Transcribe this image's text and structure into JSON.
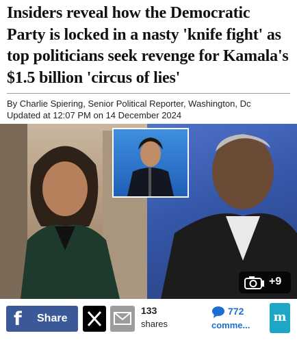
{
  "article": {
    "headline": "Insiders reveal how the Democratic Party is locked in a nasty 'knife fight' as top politicians seek revenge for Kamala's $1.5 billion 'circus of lies'",
    "byline": "By Charlie Spiering, Senior Political Reporter, Washington, Dc",
    "updated_label": "Updated at 12:07 PM on 14 December 2024"
  },
  "photo": {
    "gallery_count": "+9",
    "gallery_icon": "camera-icon",
    "colors": {
      "left_bg": "#b79d82",
      "right_bg": "#3557a9",
      "inset_bg": "#2a74cf"
    }
  },
  "share_bar": {
    "facebook_label": "Share",
    "facebook_icon": "f",
    "x_icon": "x-logo-icon",
    "email_icon": "envelope-icon",
    "shares_count": "133",
    "shares_label": "shares",
    "comments_count": "772",
    "comments_label": "comme...",
    "site_icon_text": "m",
    "colors": {
      "facebook": "#3b5998",
      "x": "#000000",
      "email": "#9c9c9c",
      "comments": "#1c6fd1",
      "site": "#1ea6c7"
    }
  }
}
